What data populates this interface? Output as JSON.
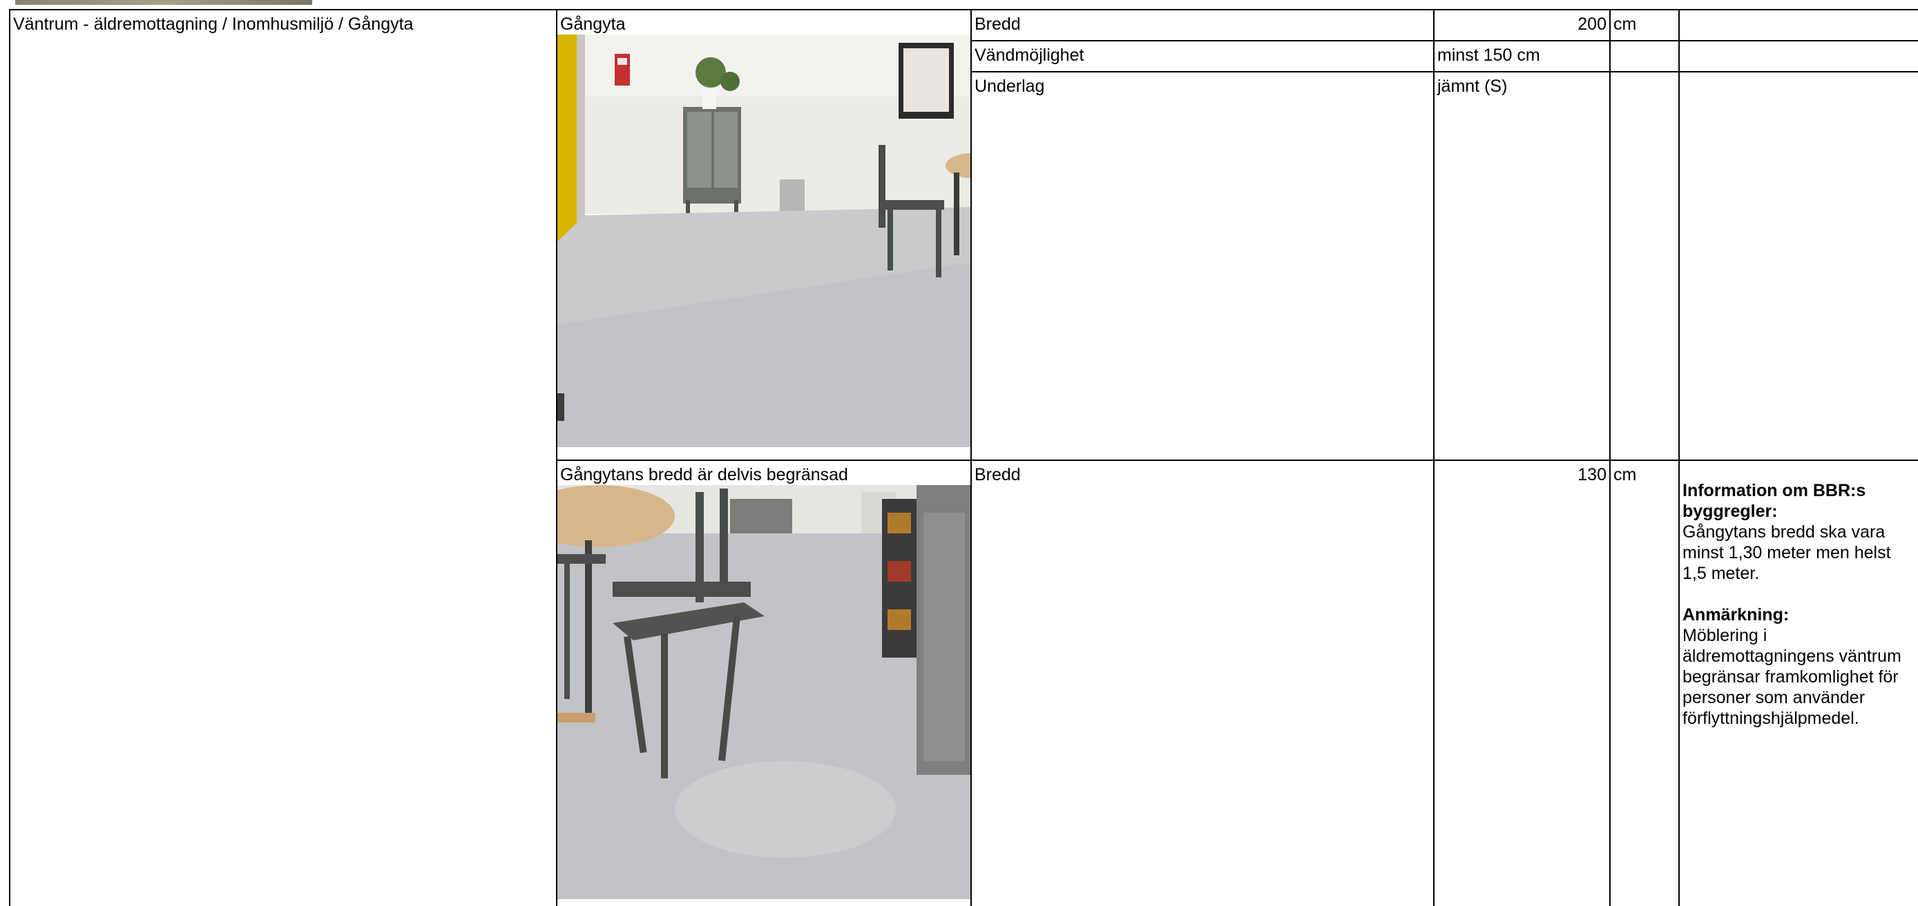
{
  "breadcrumb": "Väntrum - äldremottagning / Inomhusmiljö / Gångyta",
  "sections": [
    {
      "caption": "Gångyta",
      "photo_icon": "photo-corridor-floor",
      "rows": [
        {
          "label": "Bredd",
          "value": "200",
          "unit": "cm"
        },
        {
          "label": "Vändmöjlighet",
          "value": "minst 150 cm",
          "unit": ""
        },
        {
          "label": "Underlag",
          "value": "jämnt (S)",
          "unit": ""
        }
      ]
    },
    {
      "caption": "Gångytans bredd är delvis begränsad",
      "photo_icon": "photo-chairs-narrow-path",
      "rows": [
        {
          "label": "Bredd",
          "value": "130",
          "unit": "cm"
        }
      ],
      "note": {
        "heading1": "Information om BBR:s byggregler:",
        "text1": "Gångytans bredd ska vara minst 1,30 meter men helst 1,5 meter.",
        "heading2": "Anmärkning:",
        "text2": "Möblering i äldremottagningens väntrum begränsar framkomlighet för personer som använder förflyttningshjälpmedel."
      }
    }
  ]
}
